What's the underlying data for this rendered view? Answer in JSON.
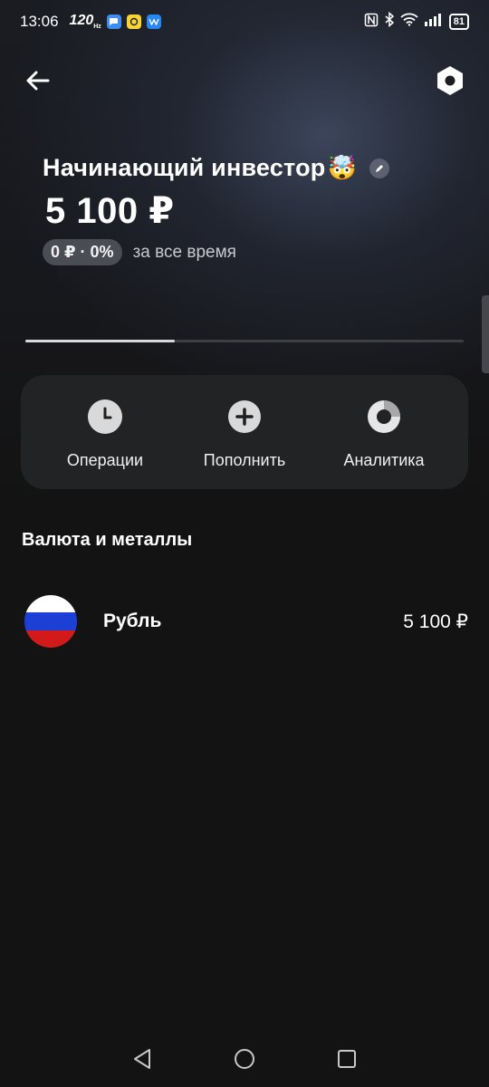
{
  "status_bar": {
    "time": "13:06",
    "refresh_rate": "120",
    "refresh_unit": "Hz",
    "battery": "81",
    "icons": [
      "messages-icon",
      "yandex-icon",
      "vk-icon",
      "nfc-icon",
      "bluetooth-icon",
      "wifi-icon",
      "signal-icon"
    ]
  },
  "nav": {
    "back_icon": "arrow-left-icon",
    "settings_icon": "hexagon-nut-icon"
  },
  "portfolio": {
    "title": "Начинающий инвестор",
    "title_emoji": "🤯",
    "balance": "5 100 ₽",
    "yield": "0 ₽ · 0%",
    "yield_caption": "за все время",
    "pager_progress": 0.34
  },
  "actions": [
    {
      "label": "Операции",
      "icon": "clock-icon"
    },
    {
      "label": "Пополнить",
      "icon": "plus-icon"
    },
    {
      "label": "Аналитика",
      "icon": "donut-chart-icon"
    }
  ],
  "section": {
    "title": "Валюта и металлы"
  },
  "assets": [
    {
      "name": "Рубль",
      "value": "5 100 ₽",
      "icon": "russia-flag-icon"
    }
  ],
  "system_nav": [
    "back-triangle-icon",
    "home-circle-icon",
    "recents-square-icon"
  ],
  "colors": {
    "background": "#131313",
    "card": "#222325",
    "pill": "#4a4d54",
    "flag_white": "#ffffff",
    "flag_blue": "#1c3fd6",
    "flag_red": "#d21a1a"
  }
}
